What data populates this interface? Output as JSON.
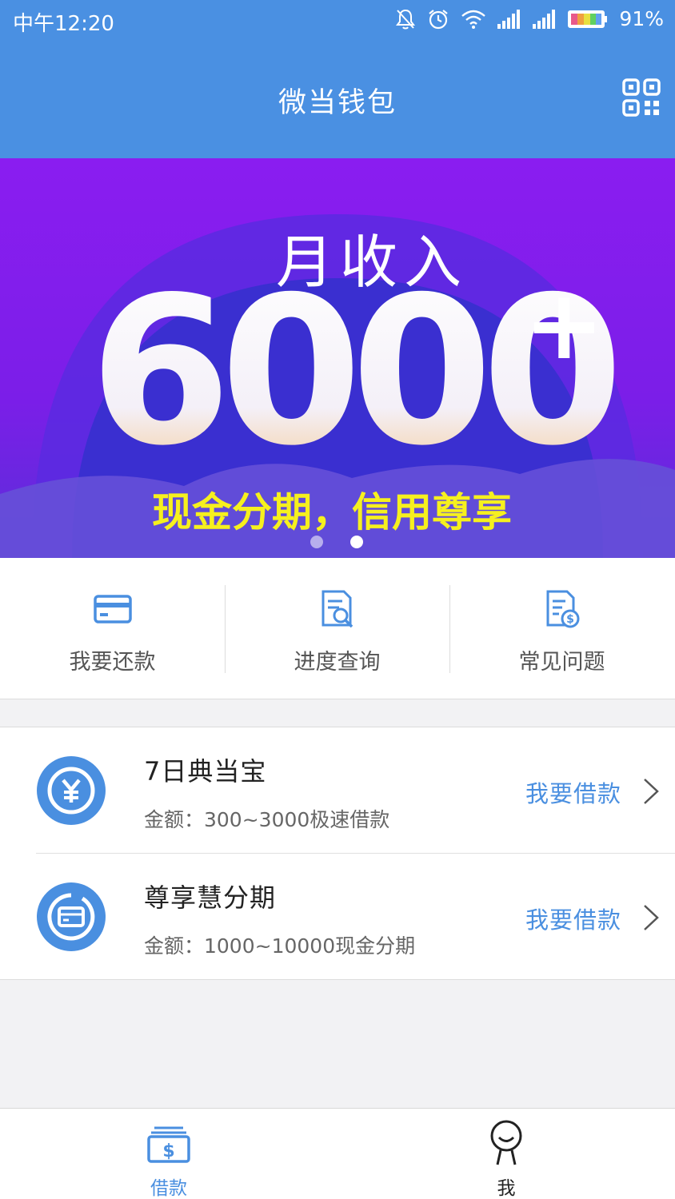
{
  "status_bar": {
    "time": "中午12:20",
    "battery": "91%",
    "icons": [
      "mute-icon",
      "alarm-icon",
      "wifi-icon",
      "signal-icon",
      "signal-icon",
      "battery-icon"
    ]
  },
  "header": {
    "title": "微当钱包",
    "right_icon": "qr-code-icon"
  },
  "banner": {
    "line1": "月收入",
    "amount": "6000",
    "plus": "+",
    "slogan": "现金分期，信用尊享",
    "slides": 2,
    "active_slide": 2,
    "colors": {
      "bg": "#8a1df0",
      "arc": "#4a2bd6",
      "slogan": "#f6f01e"
    }
  },
  "quick_actions": [
    {
      "label": "我要还款",
      "icon": "card-icon"
    },
    {
      "label": "进度查询",
      "icon": "document-search-icon"
    },
    {
      "label": "常见问题",
      "icon": "document-dollar-icon"
    }
  ],
  "loans": [
    {
      "name": "7日典当宝",
      "desc": "金额：300~3000极速借款",
      "action": "我要借款",
      "icon": "yuan-icon"
    },
    {
      "name": "尊享慧分期",
      "desc": "金额：1000~10000现金分期",
      "action": "我要借款",
      "icon": "card-circle-icon"
    }
  ],
  "tabs": [
    {
      "label": "借款",
      "icon": "money-stack-icon",
      "active": true
    },
    {
      "label": "我",
      "icon": "person-icon",
      "active": false
    }
  ],
  "colors": {
    "primary": "#4a90e2",
    "accent_text": "#4a8fe0"
  }
}
